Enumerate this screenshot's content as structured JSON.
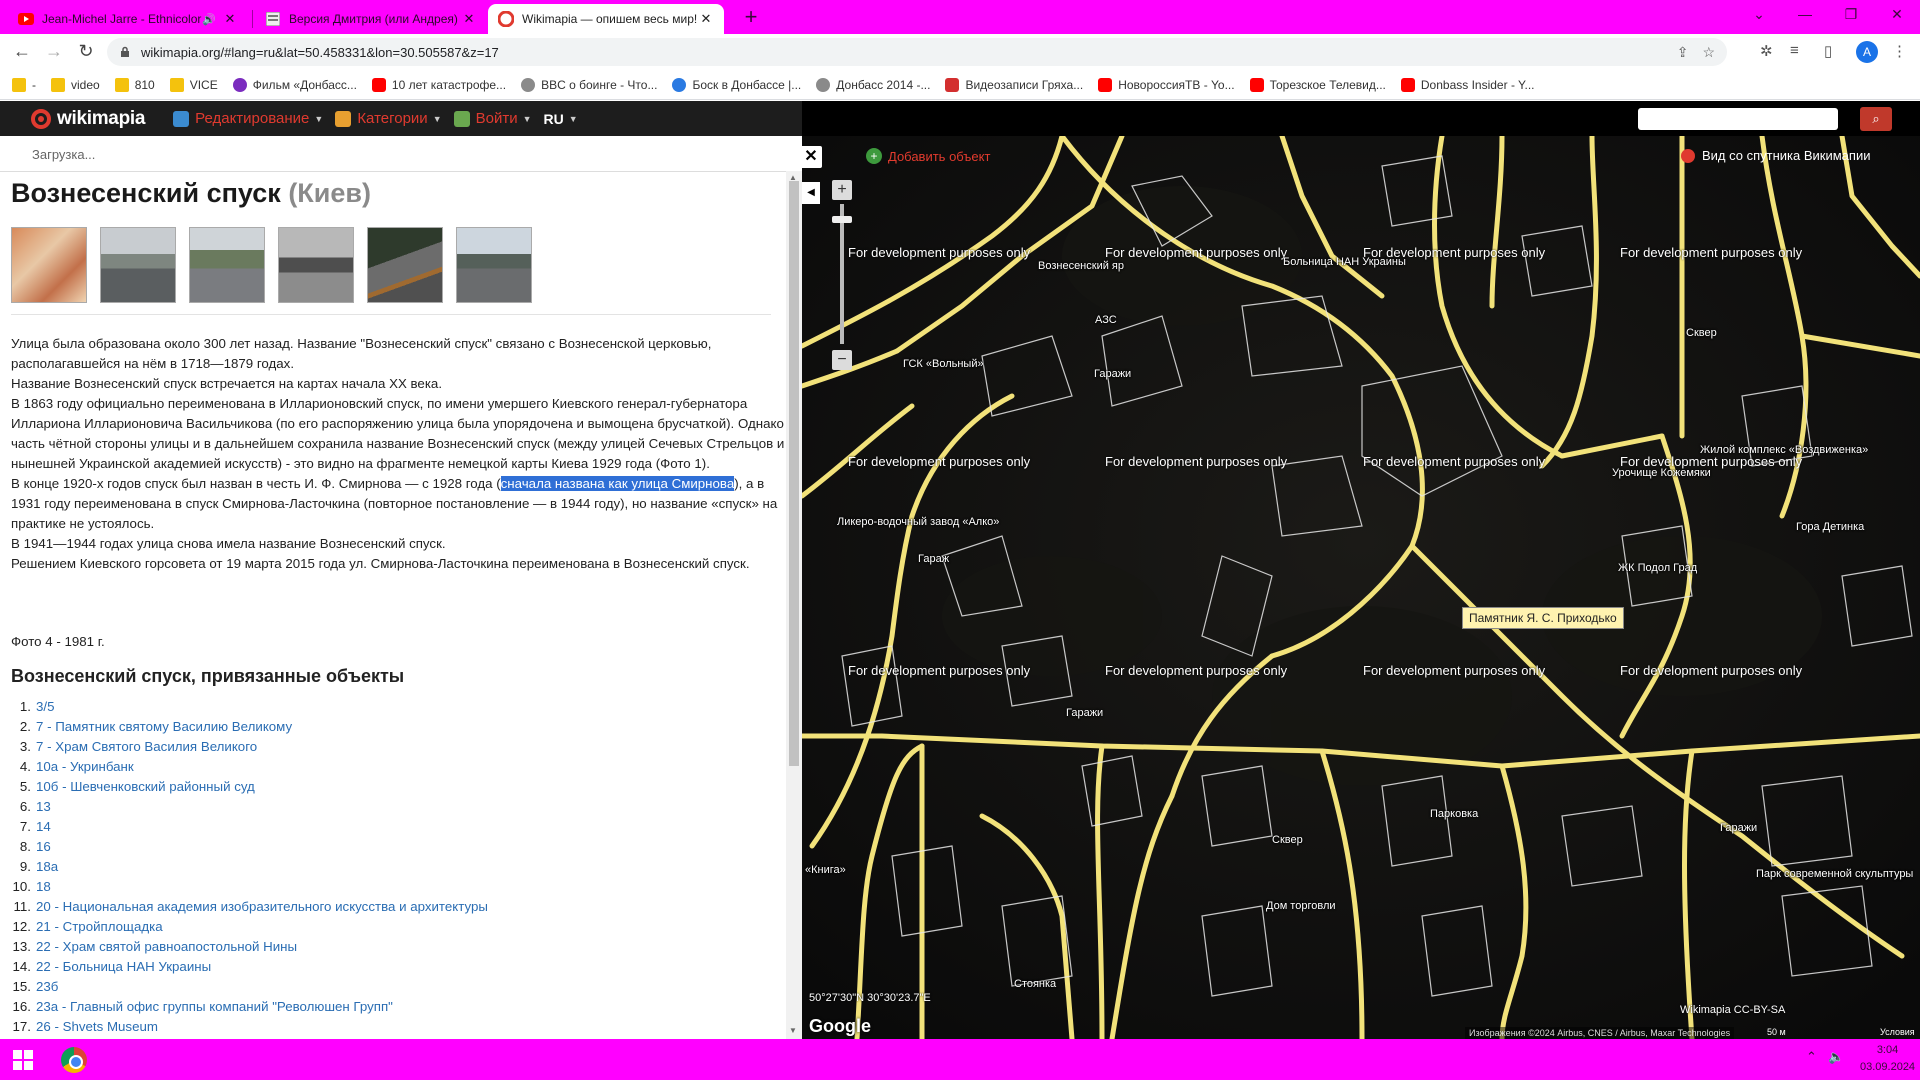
{
  "browser": {
    "tabs": [
      {
        "title": "Jean-Michel Jarre - Ethnicolor",
        "favicon": "youtube-icon",
        "audio": true
      },
      {
        "title": "Версия Дмитрия (или Андрея)",
        "favicon": "page-icon",
        "audio": false
      },
      {
        "title": "Wikimapia — опишем весь мир!",
        "favicon": "wikimapia-icon",
        "audio": false
      }
    ],
    "url": "wikimapia.org/#lang=ru&lat=50.458331&lon=30.505587&z=17",
    "profile_initial": "A",
    "bookmarks": [
      {
        "label": "-",
        "icon": "folder"
      },
      {
        "label": "video",
        "icon": "folder"
      },
      {
        "label": "810",
        "icon": "folder"
      },
      {
        "label": "VICE",
        "icon": "folder"
      },
      {
        "label": "Фильм «Донбасс...",
        "icon": "purple"
      },
      {
        "label": "10 лет катастрофе...",
        "icon": "yt"
      },
      {
        "label": "BBC о боинге - Что...",
        "icon": "gray"
      },
      {
        "label": "Боск в Донбассе |...",
        "icon": "globe"
      },
      {
        "label": "Донбасс 2014 -...",
        "icon": "gray"
      },
      {
        "label": "Видеозаписи Гряха...",
        "icon": "red"
      },
      {
        "label": "НовороссияТВ - Yo...",
        "icon": "yt"
      },
      {
        "label": "Торезское Телевид...",
        "icon": "yt"
      },
      {
        "label": "Donbass Insider - Y...",
        "icon": "yt"
      }
    ]
  },
  "wikimapia": {
    "logo_text": "wikimapia",
    "menu": [
      {
        "label": "Редактирование",
        "icon": "edit"
      },
      {
        "label": "Категории",
        "icon": "categories"
      },
      {
        "label": "Войти",
        "icon": "login"
      }
    ],
    "language": "RU"
  },
  "panel": {
    "loading_text": "Загрузка...",
    "title_main": "Вознесенский спуск",
    "title_city": "(Киев)",
    "description_paragraphs": [
      "Улица была образована около 300 лет назад. Название \"Вознесенский спуск\" связано с Вознесенской церковью, располагавшейся на нём в 1718—1879 годах.",
      "Название Вознесенский спуск встречается на картах начала XX века.",
      "В 1863 году официально переименована в Илларионовский спуск, по имени умершего Киевского генерал-губернатора Иллариона Илларионовича Васильчикова (по его распоряжению улица была упорядочена и вымощена брусчаткой). Однако часть чётной стороны улицы и в дальнейшем сохранила название Вознесенский спуск (между улицей Сечевых Стрельцов и нынешней Украинской академией искусств) - это видно на фрагменте немецкой карты Киева 1929 года (Фото 1)."
    ],
    "para4_before": "В конце 1920-х годов спуск был назван в честь И. Ф. Смирнова — с 1928 года (",
    "para4_highlight": "сначала названа как улица Смирнова",
    "para4_after": "), а в 1931 году переименована в спуск Смирнова-Ласточкина (повторное постановление — в 1944 году), но название «спуск» на практике не устоялось.",
    "para5": "В 1941—1944 годах улица снова имела название Вознесенский спуск.",
    "para6": "Решением Киевского горсовета от 19 марта 2015 года ул. Смирнова-Ласточкина переименована в Вознесенский спуск.",
    "photo_note": "Фото 4 - 1981 г.",
    "linked_title": "Вознесенский спуск, привязанные объекты",
    "linked_objects": [
      "3/5",
      "7 - Памятник святому Василию Великому",
      "7 - Храм Святого Василия Великого",
      "10а - Укринбанк",
      "10б - Шевченковский районный суд",
      "13",
      "14",
      "16",
      "18а",
      "18",
      "20 - Национальная академия изобразительного искусства и архитектуры",
      "21 - Стройплощадка",
      "22 - Храм святой равноапостольной Нины",
      "22 - Больница НАН Украины",
      "23б",
      "23а - Главный офис группы компаний \"Революшен Групп\"",
      "26 - Shvets Museum"
    ]
  },
  "map": {
    "add_object": "Добавить объект",
    "satellite_view": "Вид со спутника Викимапии",
    "watermark": "For development purposes only",
    "labels": {
      "voznesensky_yar": "Вознесенский яр",
      "hospital": "Больница НАН Украины",
      "azs": "АЗС",
      "gsk": "ГСК «Вольный»",
      "garages1": "Гаражи",
      "urochishche": "Урочище Кожемяки",
      "residential": "Жилой комплекс «Воздвиженка»",
      "square1": "Сквер",
      "distillery": "Ликеро-водочный завод «Алко»",
      "garage2": "Гараж",
      "gora_detinka": "Гора Детинка",
      "zhk_podol": "ЖК Подол Град",
      "garages3": "Гаражи",
      "kniga": "«Книга»",
      "parking": "Парковка",
      "square2": "Сквер",
      "garages4": "Гаражи",
      "park": "Парк современной скульптуры",
      "dom_torgovli": "Дом торговли",
      "stoyanka": "Стоянка"
    },
    "tooltip": "Памятник Я. С. Приходько",
    "coords": "50°27'30\"N 30°30'23.7\"E",
    "google": "Google",
    "license": "Wikimapia CC-BY-SA",
    "attribution": "Изображения ©2024 Airbus, CNES / Airbus, Maxar Technologies",
    "scale": "50 м",
    "terms": "Условия"
  },
  "taskbar": {
    "time": "3:04",
    "date": "03.09.2024"
  },
  "colors": {
    "chrome_frame": "#ff00ff",
    "wikimapia_red": "#e03a2f",
    "link_blue": "#2a6db3",
    "road_yellow": "#f2e27a"
  }
}
